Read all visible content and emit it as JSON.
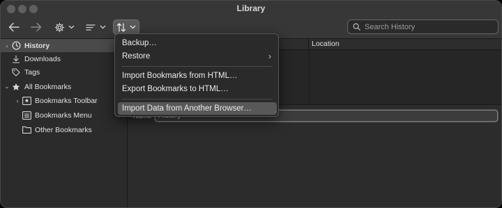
{
  "window": {
    "title": "Library"
  },
  "toolbar": {
    "search_placeholder": "Search History",
    "buttons": [
      "back-arrow-icon",
      "forward-arrow-icon",
      "gear-icon",
      "list-icon",
      "import-export-icon"
    ]
  },
  "sidebar": {
    "items": [
      {
        "label": "History",
        "icon": "clock-icon",
        "disclosure": "›",
        "selected": true
      },
      {
        "label": "Downloads",
        "icon": "download-icon",
        "disclosure": ""
      },
      {
        "label": "Tags",
        "icon": "tag-icon",
        "disclosure": ""
      },
      {
        "label": "All Bookmarks",
        "icon": "star-icon",
        "disclosure": "⌄"
      },
      {
        "label": "Bookmarks Toolbar",
        "icon": "toolbar-icon",
        "disclosure": "›"
      },
      {
        "label": "Bookmarks Menu",
        "icon": "menu-icon",
        "disclosure": ""
      },
      {
        "label": "Other Bookmarks",
        "icon": "folder-icon",
        "disclosure": ""
      }
    ]
  },
  "table": {
    "columns": [
      "Location"
    ]
  },
  "details": {
    "name_label": "Name",
    "name_value": "History"
  },
  "menu": {
    "items": [
      {
        "label": "Backup…"
      },
      {
        "label": "Restore",
        "submenu": "›"
      },
      {
        "label": "Import Bookmarks from HTML…"
      },
      {
        "label": "Export Bookmarks to HTML…"
      },
      {
        "label": "Import Data from Another Browser…",
        "highlighted": true
      }
    ]
  },
  "colors": {
    "window_bg": "#282828",
    "selection": "#4a4a4a",
    "menu_highlight": "#585858"
  }
}
